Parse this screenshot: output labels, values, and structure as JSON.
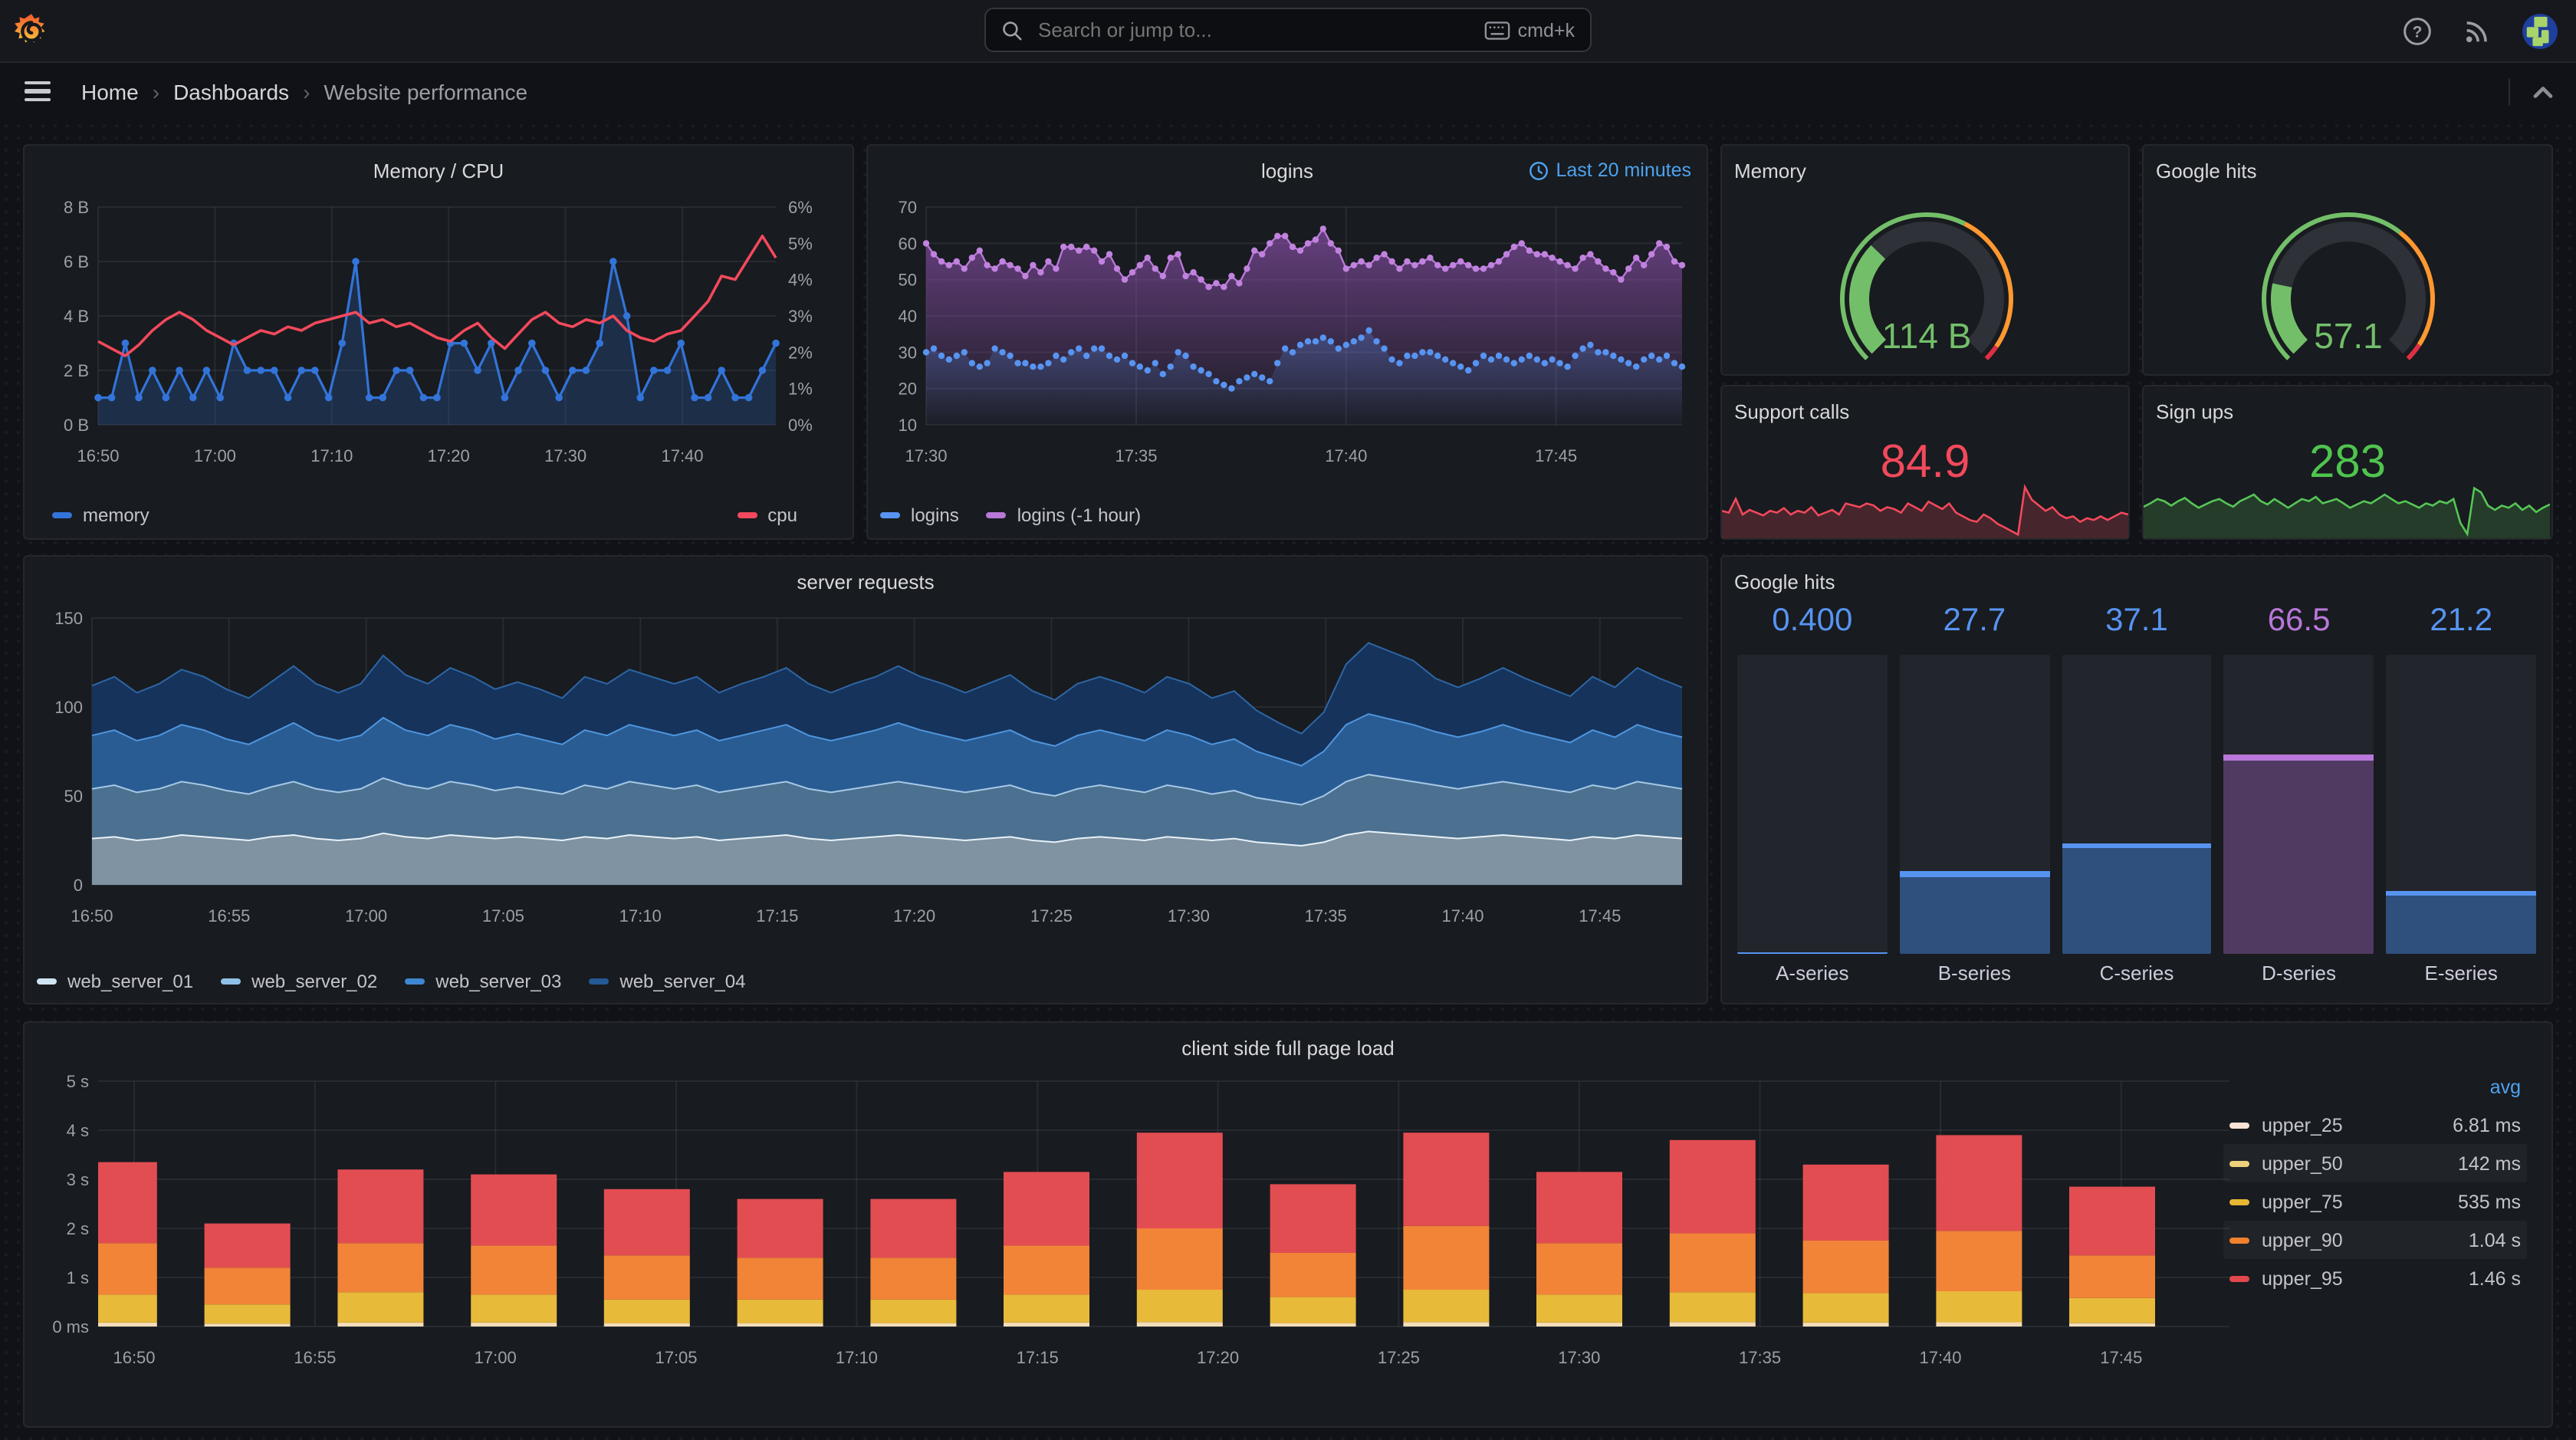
{
  "topbar": {
    "search_placeholder": "Search or jump to...",
    "search_shortcut": "cmd+k"
  },
  "breadcrumb": {
    "items": [
      "Home",
      "Dashboards",
      "Website performance"
    ],
    "separator": "›"
  },
  "panels": {
    "mem_cpu": {
      "title": "Memory / CPU",
      "type": "line",
      "legend": [
        {
          "label": "memory",
          "color": "#3274d9"
        },
        {
          "label": "cpu",
          "color": "#f2495c"
        }
      ],
      "y_left": {
        "labels": [
          "0 B",
          "2 B",
          "4 B",
          "6 B",
          "8 B"
        ],
        "max": 8
      },
      "y_right": {
        "labels": [
          "0%",
          "1%",
          "2%",
          "3%",
          "4%",
          "5%",
          "6%"
        ],
        "max": 6
      },
      "x_ticks": [
        {
          "f": 0,
          "label": "16:50"
        },
        {
          "f": 0.1724,
          "label": "17:00"
        },
        {
          "f": 0.3448,
          "label": "17:10"
        },
        {
          "f": 0.5172,
          "label": "17:20"
        },
        {
          "f": 0.6897,
          "label": "17:30"
        },
        {
          "f": 0.8621,
          "label": "17:40"
        }
      ],
      "memory_values": [
        1,
        1,
        3,
        1,
        2,
        1,
        2,
        1,
        2,
        1,
        3,
        2,
        2,
        2,
        1,
        2,
        2,
        1,
        3,
        6,
        1,
        1,
        2,
        2,
        1,
        1,
        3,
        3,
        2,
        3,
        1,
        2,
        3,
        2,
        1,
        2,
        2,
        3,
        6,
        4,
        1,
        2,
        2,
        3,
        1,
        1,
        2,
        1,
        1,
        2,
        3
      ],
      "cpu_values": [
        2.3,
        2.1,
        1.9,
        2.2,
        2.6,
        2.9,
        3.1,
        2.9,
        2.6,
        2.4,
        2.2,
        2.4,
        2.6,
        2.5,
        2.7,
        2.6,
        2.8,
        2.9,
        3.0,
        3.1,
        2.8,
        2.9,
        2.7,
        2.8,
        2.6,
        2.4,
        2.3,
        2.6,
        2.8,
        2.4,
        2.1,
        2.5,
        2.9,
        3.1,
        2.8,
        2.7,
        2.9,
        2.8,
        3.0,
        2.6,
        2.4,
        2.3,
        2.5,
        2.6,
        3.0,
        3.4,
        4.1,
        4.0,
        4.6,
        5.2,
        4.6
      ]
    },
    "logins": {
      "title": "logins",
      "type": "line",
      "time_range": "Last 20 minutes",
      "legend": [
        {
          "label": "logins",
          "color": "#5794f2"
        },
        {
          "label": "logins (-1 hour)",
          "color": "#b877d9"
        }
      ],
      "y": {
        "labels": [
          "10",
          "20",
          "30",
          "40",
          "50",
          "60",
          "70"
        ],
        "min": 10,
        "max": 70
      },
      "x_ticks": [
        {
          "f": 0,
          "label": "17:30"
        },
        {
          "f": 0.2778,
          "label": "17:35"
        },
        {
          "f": 0.5556,
          "label": "17:40"
        },
        {
          "f": 0.8333,
          "label": "17:45"
        }
      ],
      "current_values": [
        30,
        31,
        29,
        28,
        29,
        30,
        27,
        26,
        27,
        31,
        30,
        29,
        27,
        27,
        26,
        26,
        27,
        29,
        28,
        30,
        31,
        29,
        31,
        31,
        29,
        28,
        29,
        27,
        26,
        25,
        27,
        24,
        26,
        30,
        29,
        26,
        25,
        24,
        22,
        21,
        20,
        22,
        23,
        24,
        23,
        22,
        27,
        31,
        30,
        32,
        33,
        33,
        34,
        33,
        31,
        32,
        33,
        34,
        36,
        33,
        31,
        28,
        27,
        29,
        29,
        30,
        30,
        29,
        28,
        27,
        26,
        25,
        27,
        29,
        28,
        29,
        28,
        27,
        28,
        29,
        28,
        27,
        28,
        27,
        26,
        29,
        31,
        32,
        30,
        30,
        29,
        28,
        27,
        26,
        28,
        29,
        28,
        29,
        27,
        26
      ],
      "previous_values": [
        60,
        57,
        55,
        54,
        55,
        53,
        56,
        58,
        54,
        53,
        55,
        54,
        53,
        51,
        54,
        52,
        55,
        53,
        59,
        59,
        58,
        59,
        58,
        55,
        57,
        53,
        50,
        52,
        54,
        56,
        53,
        51,
        56,
        57,
        51,
        52,
        50,
        48,
        49,
        48,
        51,
        49,
        53,
        58,
        57,
        60,
        62,
        62,
        59,
        58,
        60,
        61,
        64,
        60,
        58,
        53,
        54,
        55,
        54,
        56,
        57,
        55,
        53,
        55,
        54,
        55,
        56,
        54,
        53,
        54,
        55,
        54,
        53,
        53,
        54,
        55,
        57,
        59,
        60,
        58,
        57,
        57,
        56,
        55,
        54,
        53,
        56,
        57,
        55,
        53,
        52,
        50,
        53,
        56,
        54,
        57,
        60,
        59,
        55,
        54
      ]
    },
    "memory_gauge": {
      "title": "Memory",
      "value": "114 B",
      "fraction": 0.33,
      "color": "#73bf69",
      "thresholds": [
        {
          "to": 0.6,
          "color": "#73bf69"
        },
        {
          "to": 0.96,
          "color": "#ff9830"
        },
        {
          "to": 1,
          "color": "#e02f44"
        }
      ]
    },
    "google_gauge": {
      "title": "Google hits",
      "value": "57.1",
      "fraction": 0.21,
      "color": "#73bf69",
      "thresholds": [
        {
          "to": 0.64,
          "color": "#73bf69"
        },
        {
          "to": 0.955,
          "color": "#ff9830"
        },
        {
          "to": 1,
          "color": "#e02f44"
        }
      ]
    },
    "support_calls": {
      "title": "Support calls",
      "value": "84.9",
      "color": "#f2495c",
      "fill": "rgba(242,73,92,0.22)",
      "spark": [
        62,
        60,
        75,
        58,
        63,
        60,
        57,
        62,
        60,
        65,
        58,
        62,
        60,
        66,
        57,
        60,
        63,
        58,
        70,
        68,
        66,
        70,
        68,
        62,
        66,
        64,
        60,
        70,
        66,
        62,
        72,
        68,
        64,
        70,
        60,
        56,
        52,
        50,
        58,
        54,
        48,
        44,
        40,
        36,
        88,
        74,
        68,
        62,
        66,
        58,
        54,
        56,
        50,
        54,
        52,
        56,
        52,
        56,
        60,
        58
      ]
    },
    "sign_ups": {
      "title": "Sign ups",
      "value": "283",
      "color": "#4fc44f",
      "line": "#56c556",
      "fill": "rgba(86,197,86,0.2)",
      "spark": [
        55,
        58,
        62,
        60,
        56,
        60,
        63,
        58,
        54,
        57,
        60,
        62,
        58,
        55,
        60,
        63,
        66,
        60,
        57,
        62,
        58,
        54,
        58,
        62,
        60,
        64,
        58,
        60,
        62,
        58,
        54,
        57,
        60,
        58,
        62,
        66,
        62,
        58,
        60,
        57,
        54,
        58,
        56,
        60,
        58,
        62,
        40,
        30,
        72,
        68,
        56,
        52,
        56,
        54,
        58,
        52,
        56,
        50,
        54,
        57
      ]
    },
    "server_requests": {
      "title": "server requests",
      "type": "stacked-area",
      "y": {
        "labels": [
          "0",
          "50",
          "100",
          "150"
        ],
        "max": 150
      },
      "x_ticks": [
        {
          "f": 0,
          "label": "16:50"
        },
        {
          "f": 0.0862,
          "label": "16:55"
        },
        {
          "f": 0.1724,
          "label": "17:00"
        },
        {
          "f": 0.2586,
          "label": "17:05"
        },
        {
          "f": 0.3448,
          "label": "17:10"
        },
        {
          "f": 0.431,
          "label": "17:15"
        },
        {
          "f": 0.5172,
          "label": "17:20"
        },
        {
          "f": 0.6034,
          "label": "17:25"
        },
        {
          "f": 0.6897,
          "label": "17:30"
        },
        {
          "f": 0.7759,
          "label": "17:35"
        },
        {
          "f": 0.8621,
          "label": "17:40"
        },
        {
          "f": 0.9483,
          "label": "17:45"
        }
      ],
      "series": [
        {
          "name": "web_server_01",
          "line": "#e9f2f9",
          "fill": "#7f93a3",
          "swatch": "#cfe3f2",
          "values": [
            26,
            27,
            25,
            26,
            28,
            27,
            26,
            25,
            27,
            28,
            26,
            25,
            26,
            29,
            27,
            26,
            28,
            27,
            26,
            27,
            26,
            25,
            27,
            26,
            28,
            27,
            26,
            27,
            25,
            26,
            27,
            28,
            26,
            25,
            26,
            27,
            28,
            27,
            26,
            25,
            26,
            27,
            25,
            24,
            26,
            27,
            26,
            25,
            27,
            26,
            25,
            26,
            24,
            23,
            22,
            24,
            28,
            30,
            29,
            28,
            27,
            26,
            27,
            28,
            27,
            26,
            25,
            27,
            26,
            28,
            27,
            26
          ]
        },
        {
          "name": "web_server_02",
          "line": "#a6c9e6",
          "fill": "#4c708f",
          "swatch": "#8fc0e8",
          "values": [
            28,
            29,
            27,
            28,
            30,
            29,
            27,
            26,
            28,
            30,
            28,
            27,
            28,
            31,
            29,
            28,
            30,
            29,
            27,
            28,
            27,
            26,
            29,
            28,
            30,
            29,
            28,
            29,
            27,
            28,
            29,
            30,
            28,
            27,
            28,
            29,
            30,
            29,
            28,
            27,
            28,
            29,
            27,
            26,
            28,
            29,
            28,
            27,
            29,
            28,
            26,
            27,
            25,
            24,
            23,
            26,
            30,
            32,
            31,
            30,
            29,
            28,
            29,
            30,
            29,
            28,
            27,
            29,
            28,
            30,
            29,
            28
          ]
        },
        {
          "name": "web_server_03",
          "line": "#4f96dd",
          "fill": "#2a5c94",
          "swatch": "#3d87d3",
          "values": [
            30,
            31,
            29,
            30,
            32,
            31,
            29,
            28,
            30,
            33,
            30,
            29,
            30,
            34,
            31,
            30,
            32,
            31,
            29,
            30,
            29,
            28,
            31,
            30,
            32,
            31,
            30,
            31,
            29,
            30,
            31,
            32,
            30,
            29,
            30,
            31,
            33,
            31,
            30,
            29,
            30,
            31,
            29,
            28,
            30,
            31,
            30,
            29,
            31,
            30,
            28,
            29,
            26,
            24,
            22,
            25,
            32,
            34,
            33,
            32,
            30,
            29,
            30,
            32,
            30,
            29,
            28,
            31,
            29,
            32,
            30,
            29
          ]
        },
        {
          "name": "web_server_04",
          "line": "#2e66a5",
          "fill": "#16335c",
          "swatch": "#235a96",
          "values": [
            28,
            30,
            27,
            29,
            31,
            30,
            28,
            26,
            29,
            32,
            29,
            27,
            29,
            35,
            31,
            29,
            32,
            30,
            28,
            29,
            28,
            26,
            30,
            29,
            31,
            30,
            29,
            30,
            27,
            29,
            30,
            32,
            29,
            27,
            29,
            30,
            32,
            30,
            29,
            27,
            29,
            31,
            28,
            26,
            29,
            30,
            29,
            27,
            30,
            29,
            26,
            27,
            23,
            20,
            18,
            22,
            34,
            40,
            38,
            36,
            30,
            28,
            30,
            32,
            30,
            28,
            26,
            30,
            28,
            32,
            30,
            28
          ]
        }
      ]
    },
    "google_hits_bars": {
      "title": "Google hits",
      "type": "bar-gauge",
      "max": 100,
      "bars": [
        {
          "label": "A-series",
          "display": "0.400",
          "value": 0.4,
          "cap": "#5794f2",
          "fill": "#2f4f7d"
        },
        {
          "label": "B-series",
          "display": "27.7",
          "value": 27.7,
          "cap": "#5794f2",
          "fill": "#2f4f7d"
        },
        {
          "label": "C-series",
          "display": "37.1",
          "value": 37.1,
          "cap": "#5794f2",
          "fill": "#2f4f7d"
        },
        {
          "label": "D-series",
          "display": "66.5",
          "value": 66.5,
          "cap": "#b877d9",
          "fill": "#503a61"
        },
        {
          "label": "E-series",
          "display": "21.2",
          "value": 21.2,
          "cap": "#5794f2",
          "fill": "#2f4f7d"
        }
      ]
    },
    "page_load": {
      "title": "client side full page load",
      "type": "stacked-bar",
      "y": {
        "labels": [
          "0 ms",
          "1 s",
          "2 s",
          "3 s",
          "4 s",
          "5 s"
        ],
        "max": 5
      },
      "x_ticks": [
        {
          "f": 0.0169,
          "label": "16:50"
        },
        {
          "f": 0.1017,
          "label": "16:55"
        },
        {
          "f": 0.1864,
          "label": "17:00"
        },
        {
          "f": 0.2712,
          "label": "17:05"
        },
        {
          "f": 0.3559,
          "label": "17:10"
        },
        {
          "f": 0.4407,
          "label": "17:15"
        },
        {
          "f": 0.5254,
          "label": "17:20"
        },
        {
          "f": 0.6102,
          "label": "17:25"
        },
        {
          "f": 0.6949,
          "label": "17:30"
        },
        {
          "f": 0.7797,
          "label": "17:35"
        },
        {
          "f": 0.8644,
          "label": "17:40"
        },
        {
          "f": 0.9492,
          "label": "17:45"
        }
      ],
      "segment_colors": [
        "#f3ddb9",
        "#e8ba3a",
        "#f28438",
        "#e24d52"
      ],
      "bars": [
        [
          0.08,
          0.65,
          1.7,
          3.35
        ],
        [
          0.06,
          0.45,
          1.2,
          2.1
        ],
        [
          0.08,
          0.7,
          1.7,
          3.2
        ],
        [
          0.08,
          0.65,
          1.65,
          3.1
        ],
        [
          0.07,
          0.55,
          1.45,
          2.8
        ],
        [
          0.07,
          0.55,
          1.4,
          2.6
        ],
        [
          0.07,
          0.55,
          1.4,
          2.6
        ],
        [
          0.08,
          0.65,
          1.65,
          3.15
        ],
        [
          0.09,
          0.75,
          2.0,
          3.95
        ],
        [
          0.07,
          0.6,
          1.5,
          2.9
        ],
        [
          0.09,
          0.75,
          2.05,
          3.95
        ],
        [
          0.08,
          0.65,
          1.7,
          3.15
        ],
        [
          0.09,
          0.7,
          1.9,
          3.8
        ],
        [
          0.08,
          0.68,
          1.75,
          3.3
        ],
        [
          0.09,
          0.72,
          1.95,
          3.9
        ],
        [
          0.07,
          0.58,
          1.45,
          2.85
        ]
      ],
      "legend": {
        "header": "avg",
        "rows": [
          {
            "label": "upper_25",
            "value": "6.81 ms",
            "color": "#f7e4d6",
            "striped": false
          },
          {
            "label": "upper_50",
            "value": "142 ms",
            "color": "#eed07a",
            "striped": true
          },
          {
            "label": "upper_75",
            "value": "535 ms",
            "color": "#e7b733",
            "striped": false
          },
          {
            "label": "upper_90",
            "value": "1.04 s",
            "color": "#f0812d",
            "striped": true
          },
          {
            "label": "upper_95",
            "value": "1.46 s",
            "color": "#e0484e",
            "striped": false
          }
        ]
      }
    }
  }
}
